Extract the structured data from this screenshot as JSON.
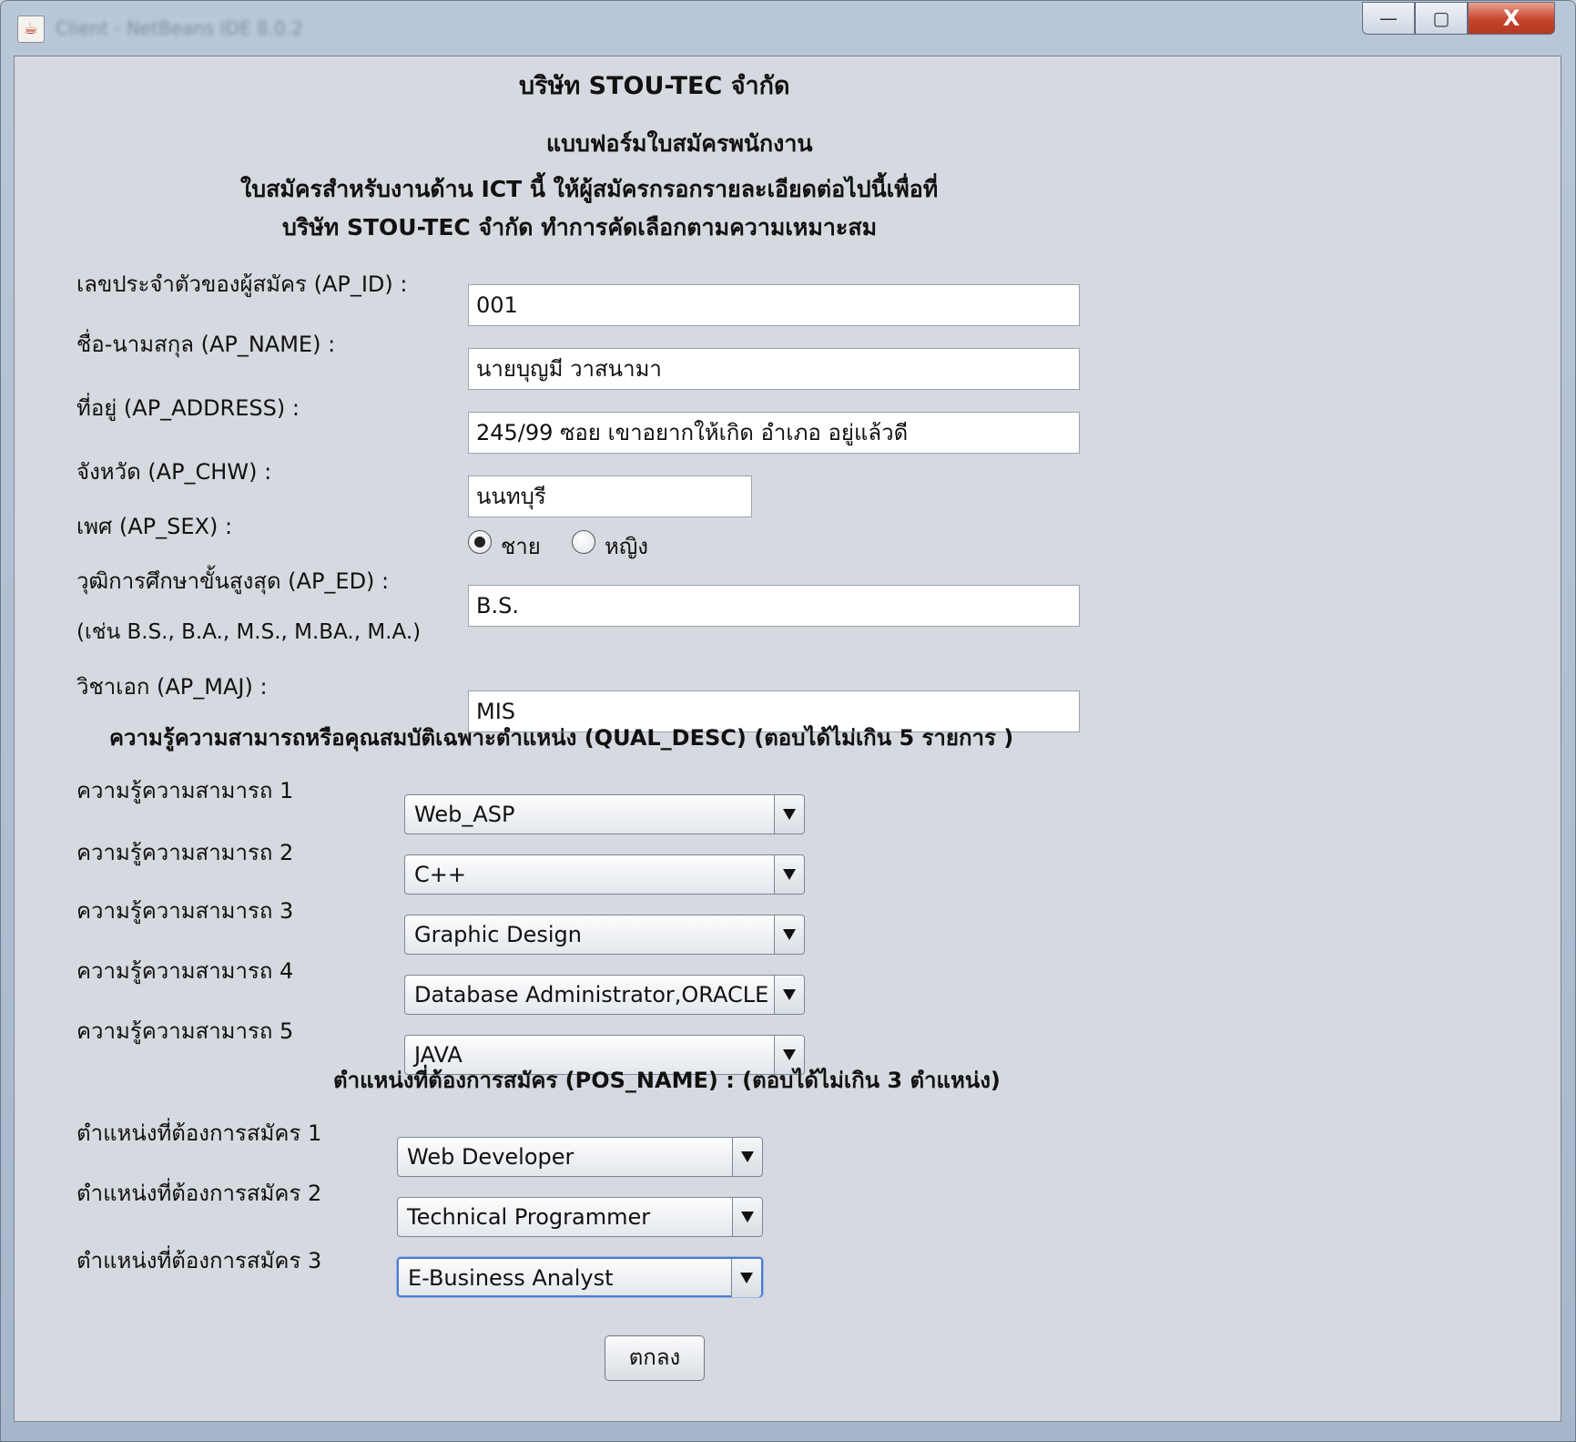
{
  "window": {
    "title": "Client - NetBeans IDE 8.0.2",
    "controls": {
      "minimize": "—",
      "maximize": "▢",
      "close": "X"
    }
  },
  "header": {
    "company": "บริษัท STOU-TEC จำกัด",
    "form_title": "แบบฟอร์มใบสมัครพนักงาน",
    "intro_line1": "ใบสมัครสำหรับงานด้าน ICT นี้   ให้ผู้สมัครกรอกรายละเอียดต่อไปนี้เพื่อที่",
    "intro_line2": "บริษัท STOU-TEC จำกัด ทำการคัดเลือกตามความเหมาะสม"
  },
  "fields": {
    "ap_id": {
      "label": "เลขประจำตัวของผู้สมัคร (AP_ID) :",
      "value": "001"
    },
    "ap_name": {
      "label": "ชื่อ-นามสกุล (AP_NAME) :",
      "value": "นายบุญมี วาสนามา"
    },
    "ap_address": {
      "label": "ที่อยู่ (AP_ADDRESS) :",
      "value": "245/99 ซอย เขาอยากให้เกิด  อำเภอ อยู่แล้วดี"
    },
    "ap_chw": {
      "label": "จังหวัด (AP_CHW) :",
      "value": "นนทบุรี"
    },
    "ap_sex": {
      "label": "เพศ (AP_SEX) :",
      "option_male": "ชาย",
      "option_female": "หญิง",
      "selected": "ชาย"
    },
    "ap_ed": {
      "label": "วุฒิการศึกษาขั้นสูงสุด (AP_ED) :",
      "hint": "(เช่น B.S., B.A., M.S., M.BA., M.A.)",
      "value": "B.S."
    },
    "ap_maj": {
      "label": "วิชาเอก (AP_MAJ) :",
      "value": "MIS"
    }
  },
  "qualifications": {
    "section_title": "ความรู้ความสามารถหรือคุณสมบัติเฉพาะตำแหน่ง  (QUAL_DESC) (ตอบได้ไม่เกิน 5 รายการ )",
    "items": [
      {
        "label": "ความรู้ความสามารถ 1",
        "value": "Web_ASP"
      },
      {
        "label": "ความรู้ความสามารถ 2",
        "value": "C++"
      },
      {
        "label": "ความรู้ความสามารถ 3",
        "value": "Graphic Design"
      },
      {
        "label": "ความรู้ความสามารถ 4",
        "value": "Database Administrator,ORACLE"
      },
      {
        "label": "ความรู้ความสามารถ 5",
        "value": "JAVA"
      }
    ]
  },
  "positions": {
    "section_title": "ตำแหน่งที่ต้องการสมัคร (POS_NAME)  :   (ตอบได้ไม่เกิน 3 ตำแหน่ง)",
    "items": [
      {
        "label": "ตำแหน่งที่ต้องการสมัคร 1",
        "value": "Web Developer"
      },
      {
        "label": "ตำแหน่งที่ต้องการสมัคร 2",
        "value": "Technical Programmer"
      },
      {
        "label": "ตำแหน่งที่ต้องการสมัคร 3",
        "value": "E-Business Analyst"
      }
    ]
  },
  "actions": {
    "ok_label": "ตกลง"
  }
}
